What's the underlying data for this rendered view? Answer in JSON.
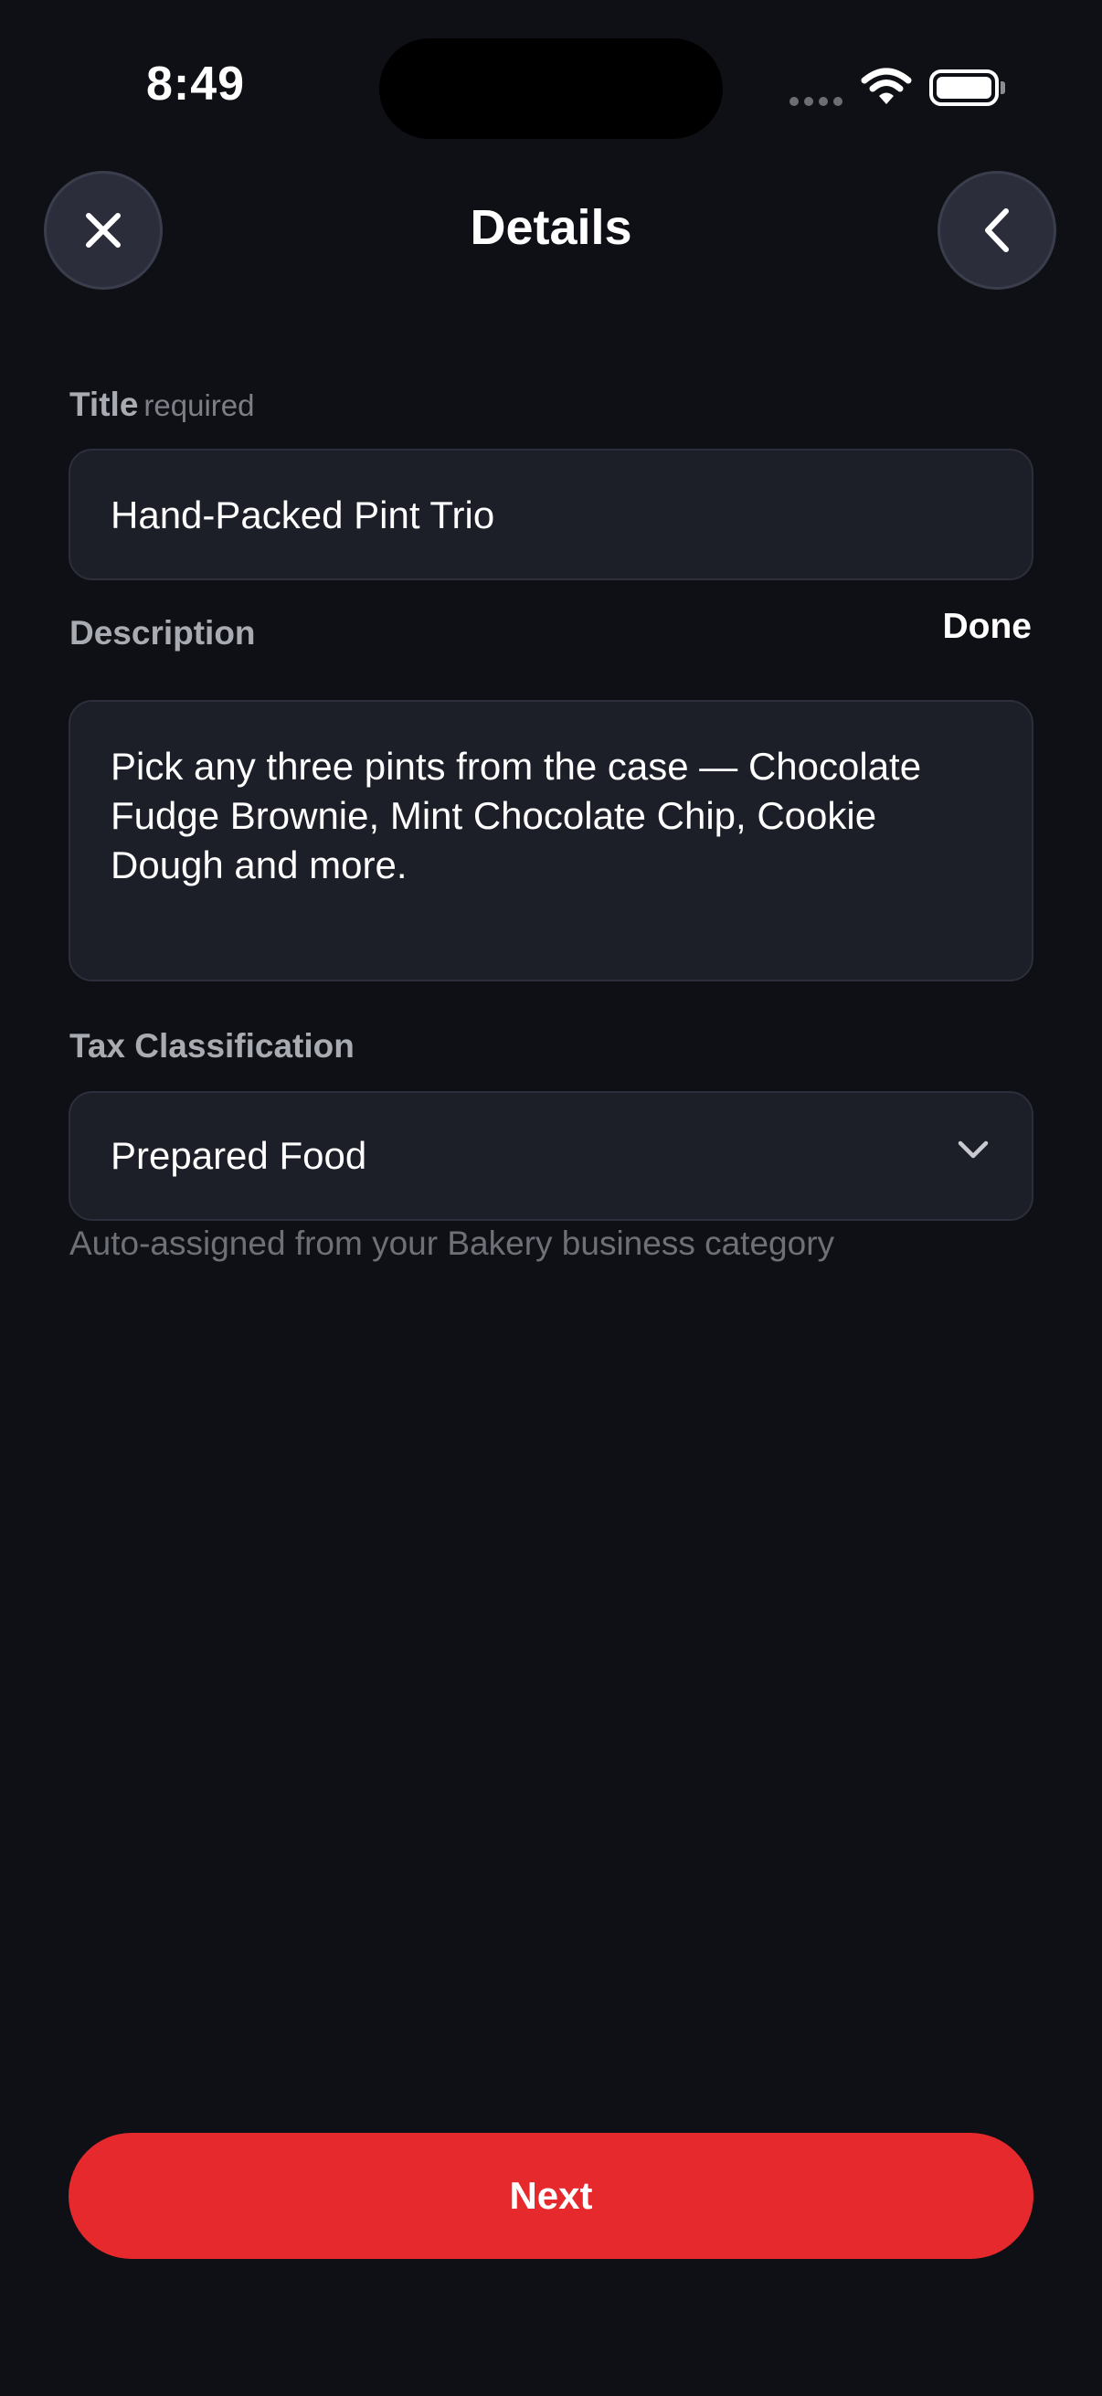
{
  "status_bar": {
    "time": "8:49"
  },
  "header": {
    "title": "Details",
    "close_icon": "close-icon",
    "back_icon": "chevron-left-icon"
  },
  "form": {
    "title_label": "Title",
    "title_required": "required",
    "title_value": "Hand-Packed Pint Trio",
    "description_label": "Description",
    "done_label": "Done",
    "description_value": "Pick any three pints from the case — Chocolate Fudge Brownie, Mint Chocolate Chip, Cookie Dough and more.",
    "tax_label": "Tax Classification",
    "tax_value": "Prepared Food",
    "tax_helper": "Auto-assigned from your Bakery business category"
  },
  "footer": {
    "next_label": "Next"
  },
  "colors": {
    "background": "#0f1015",
    "field_background": "#1c1e28",
    "accent": "#e5292c"
  }
}
